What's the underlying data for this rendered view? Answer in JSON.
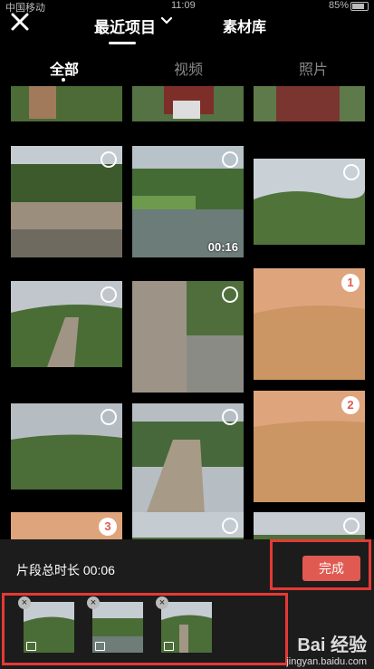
{
  "status": {
    "carrier": "中国移动",
    "time": "11:09",
    "battery": "85%"
  },
  "header": {
    "close_icon": "close-icon",
    "title": "最近项目",
    "library": "素材库"
  },
  "tabs": [
    {
      "label": "全部"
    },
    {
      "label": "视频"
    },
    {
      "label": "照片"
    }
  ],
  "grid": {
    "video_duration": "00:16",
    "selected_order": [
      "1",
      "2",
      "3"
    ]
  },
  "bottom": {
    "total_label": "片段总时长 00:06",
    "done_label": "完成",
    "remove_glyph": "×"
  },
  "watermark": {
    "brand": "Bai 经验",
    "url": "jingyan.baidu.com"
  },
  "colors": {
    "accent": "#e05a52",
    "highlight": "#e53935",
    "selected_tint": "#e29c6c"
  }
}
